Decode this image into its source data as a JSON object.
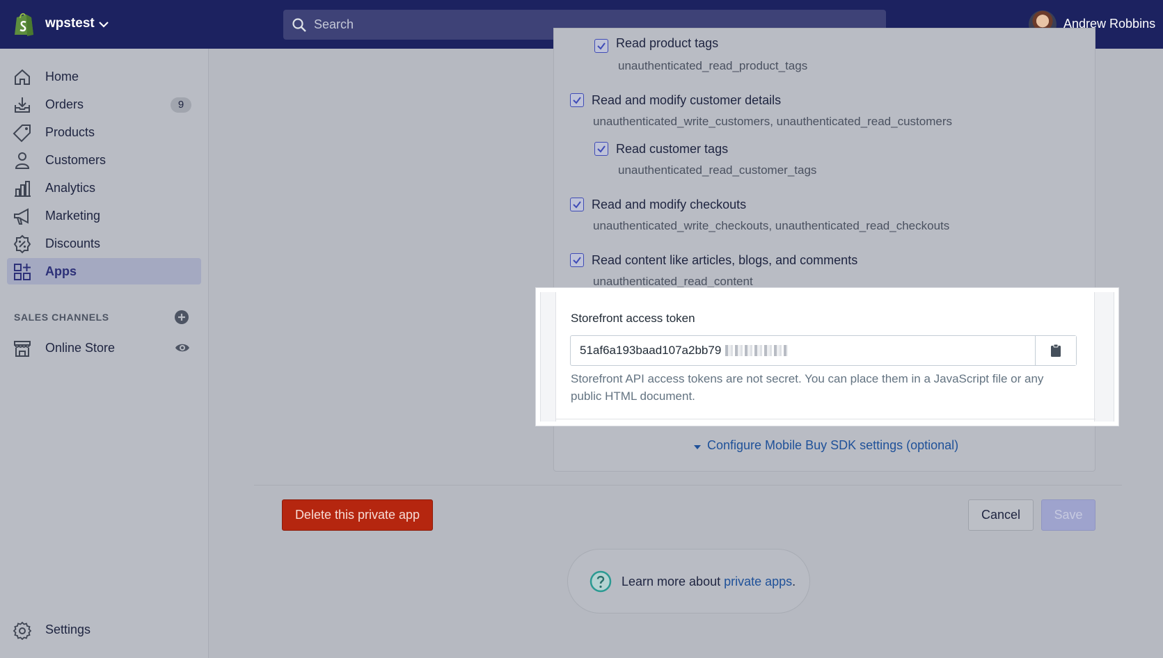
{
  "topbar": {
    "store_name": "wpstest",
    "search_placeholder": "Search",
    "user_name": "Andrew Robbins"
  },
  "sidebar": {
    "items": [
      {
        "label": "Home",
        "icon": "home-icon"
      },
      {
        "label": "Orders",
        "icon": "orders-icon",
        "badge": "9"
      },
      {
        "label": "Products",
        "icon": "tag-icon"
      },
      {
        "label": "Customers",
        "icon": "person-icon"
      },
      {
        "label": "Analytics",
        "icon": "bar-chart-icon"
      },
      {
        "label": "Marketing",
        "icon": "megaphone-icon"
      },
      {
        "label": "Discounts",
        "icon": "discount-icon"
      },
      {
        "label": "Apps",
        "icon": "apps-icon",
        "active": true
      }
    ],
    "sales_channels_title": "SALES CHANNELS",
    "online_store_label": "Online Store",
    "settings_label": "Settings"
  },
  "permissions": {
    "partial_label": "Read product tags",
    "partial_desc": "unauthenticated_read_product_tags",
    "items": [
      {
        "label": "Read and modify customer details",
        "desc": "unauthenticated_write_customers, unauthenticated_read_customers",
        "checked": true
      },
      {
        "label": "Read customer tags",
        "desc": "unauthenticated_read_customer_tags",
        "checked": true
      },
      {
        "label": "Read and modify checkouts",
        "desc": "unauthenticated_write_checkouts, unauthenticated_read_checkouts",
        "checked": true
      },
      {
        "label": "Read content like articles, blogs, and comments",
        "desc": "unauthenticated_read_content",
        "checked": true
      }
    ]
  },
  "token": {
    "label": "Storefront access token",
    "value": "51af6a193baad107a2bb79",
    "help": "Storefront API access tokens are not secret. You can place them in a JavaScript file or any public HTML document."
  },
  "sdk_link": "Configure Mobile Buy SDK settings (optional)",
  "actions": {
    "delete_label": "Delete this private app",
    "cancel_label": "Cancel",
    "save_label": "Save"
  },
  "help": {
    "prefix": "Learn more about ",
    "link": "private apps",
    "suffix": "."
  },
  "colors": {
    "topbar": "#1c2260",
    "delete": "#b5260f",
    "link": "#1f5199",
    "checkbox": "#3f4bb6"
  }
}
